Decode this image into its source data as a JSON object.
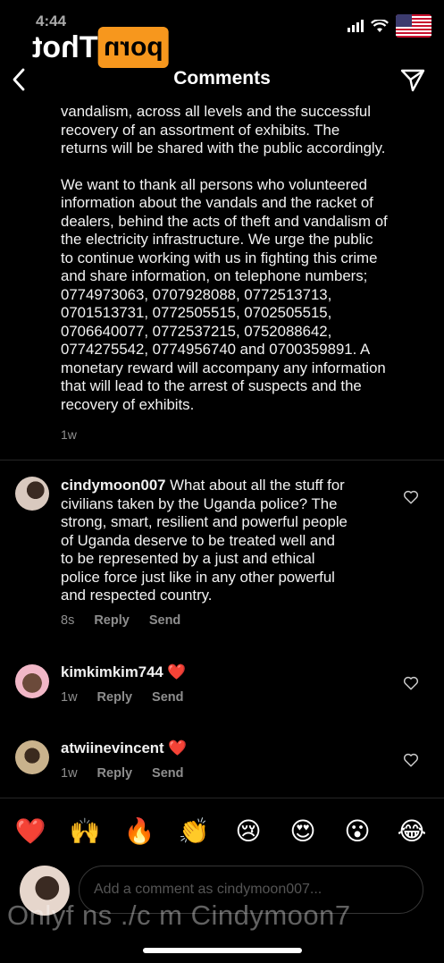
{
  "status": {
    "time": "4:44"
  },
  "logo": {
    "box": "porn",
    "text": "Thot"
  },
  "header": {
    "title": "Comments"
  },
  "post": {
    "paragraphs": [
      "vandalism, across all levels and the successful\nrecovery of an assortment of exhibits. The\nreturns will be shared with the public accordingly.",
      "We want to thank all persons who volunteered\ninformation about the vandals and the racket of\ndealers, behind the acts of theft and vandalism of\nthe electricity infrastructure. We urge the public\nto continue working with us in fighting this crime\nand share information, on telephone numbers;\n0774973063, 0707928088, 0772513713,\n0701513731, 0772505515, 0702505515,\n0706640077, 0772537215, 0752088642,\n0774275542, 0774956740 and 0700359891. A\nmonetary reward will accompany any information\nthat will lead to the arrest of suspects and the\nrecovery of exhibits."
    ],
    "time": "1w"
  },
  "comments": [
    {
      "username": "cindymoon007",
      "text": " What about all the stuff for\ncivilians taken by the Uganda police? The\nstrong, smart, resilient and powerful people\nof Uganda deserve to be treated well and\nto be represented by a just and ethical\npolice force just like in any other powerful\nand respected country.",
      "time": "8s",
      "reply": "Reply",
      "send": "Send"
    },
    {
      "username": "kimkimkim744",
      "text": " ❤️",
      "time": "1w",
      "reply": "Reply",
      "send": "Send"
    },
    {
      "username": "atwiinevincent",
      "text": " ❤️",
      "time": "1w",
      "reply": "Reply",
      "send": "Send"
    }
  ],
  "reactions": [
    "❤️",
    "🙌",
    "🔥",
    "👏",
    "😢",
    "😍",
    "😮",
    "😂"
  ],
  "composer": {
    "placeholder": "Add a comment as cindymoon007..."
  },
  "watermark": "Onlyf ns ./c m Cindymoon7",
  "colors": {
    "background": "#000000",
    "muted": "#8e8e8e",
    "heart": "#ed2f3d",
    "logo": "#f7971d"
  }
}
